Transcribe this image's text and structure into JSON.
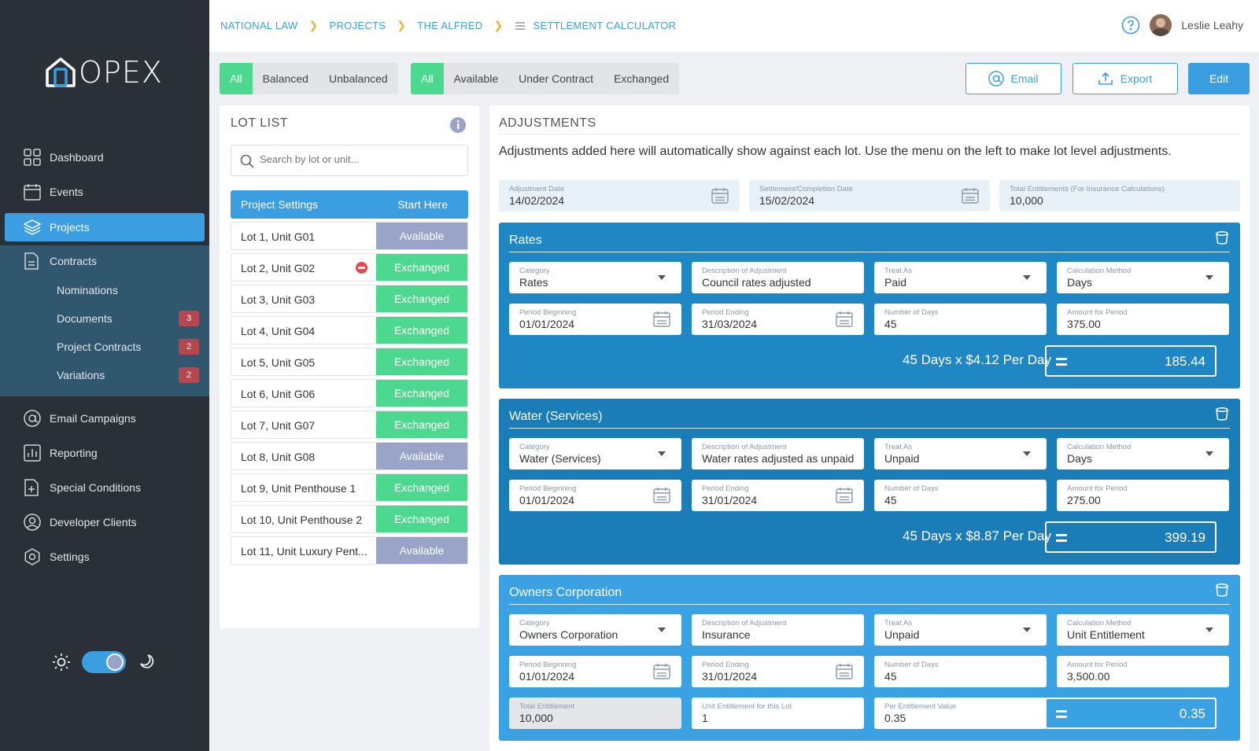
{
  "app": {
    "logo": "OPEX"
  },
  "sidebar": {
    "items": [
      {
        "label": "Dashboard"
      },
      {
        "label": "Events"
      },
      {
        "label": "Projects"
      },
      {
        "label": "Contracts"
      },
      {
        "label": "Email Campaigns"
      },
      {
        "label": "Reporting"
      },
      {
        "label": "Special Conditions"
      },
      {
        "label": "Developer Clients"
      },
      {
        "label": "Settings"
      }
    ],
    "sub_items": [
      {
        "label": "Nominations",
        "badge": ""
      },
      {
        "label": "Documents",
        "badge": "3"
      },
      {
        "label": "Project Contracts",
        "badge": "2"
      },
      {
        "label": "Variations",
        "badge": "2"
      }
    ]
  },
  "breadcrumb": [
    "NATIONAL LAW",
    "PROJECTS",
    "THE ALFRED",
    "SETTLEMENT CALCULATOR"
  ],
  "user": {
    "name": "Leslie Leahy"
  },
  "filters": {
    "balance": [
      "All",
      "Balanced",
      "Unbalanced"
    ],
    "status": [
      "All",
      "Available",
      "Under Contract",
      "Exchanged"
    ]
  },
  "actions": {
    "email": "Email",
    "export": "Export",
    "edit": "Edit"
  },
  "lot_list": {
    "title": "LOT LIST",
    "search_placeholder": "Search by lot or unit...",
    "project_settings": "Project Settings",
    "start_here": "Start Here",
    "lots": [
      {
        "name": "Lot 1, Unit G01",
        "status": "Available"
      },
      {
        "name": "Lot 2, Unit G02",
        "status": "Exchanged"
      },
      {
        "name": "Lot 3, Unit G03",
        "status": "Exchanged"
      },
      {
        "name": "Lot 4, Unit G04",
        "status": "Exchanged"
      },
      {
        "name": "Lot 5, Unit G05",
        "status": "Exchanged"
      },
      {
        "name": "Lot 6, Unit G06",
        "status": "Exchanged"
      },
      {
        "name": "Lot 7, Unit G07",
        "status": "Exchanged"
      },
      {
        "name": "Lot 8, Unit G08",
        "status": "Available"
      },
      {
        "name": "Lot 9, Unit Penthouse 1",
        "status": "Exchanged"
      },
      {
        "name": "Lot 10, Unit Penthouse 2",
        "status": "Exchanged"
      },
      {
        "name": "Lot 11, Unit Luxury Pent...",
        "status": "Available"
      }
    ]
  },
  "adjustments": {
    "title": "ADJUSTMENTS",
    "description": "Adjustments added here will automatically show against each lot. Use the menu on the left to make lot level adjustments.",
    "adjustment_date": {
      "label": "Adjustment Date",
      "value": "14/02/2024"
    },
    "settlement_date": {
      "label": "Settlement/Completion Date",
      "value": "15/02/2024"
    },
    "total_entitlements": {
      "label": "Total Entitlements (For Insurance Calculations)",
      "value": "10,000"
    },
    "labels": {
      "category": "Category",
      "description": "Description of Adjustment",
      "treat_as": "Treat As",
      "calc_method": "Calculation Method",
      "period_beginning": "Period Beginning",
      "period_ending": "Period Ending",
      "days": "Number of Days",
      "amount": "Amount for Period",
      "total_entitlement": "Total Entitlement",
      "unit_entitlement": "Unit Entitlement for this Lot",
      "per_entitlement": "Per Entitlement Value"
    },
    "rates": {
      "title": "Rates",
      "category": "Rates",
      "description": "Council rates adjusted",
      "treat_as": "Paid",
      "calc_method": "Days",
      "period_beginning": "01/01/2024",
      "period_ending": "31/03/2024",
      "days": "45",
      "amount": "375.00",
      "formula": "45 Days x $4.12 Per Day",
      "result": "185.44"
    },
    "water": {
      "title": "Water (Services)",
      "category": "Water (Services)",
      "description": "Water rates adjusted as unpaid",
      "treat_as": "Unpaid",
      "calc_method": "Days",
      "period_beginning": "01/01/2024",
      "period_ending": "31/01/2024",
      "days": "45",
      "amount": "275.00",
      "formula": "45 Days x $8.87 Per Day",
      "result": "399.19"
    },
    "owners": {
      "title": "Owners Corporation",
      "category": "Owners Corporation",
      "description": "Insurance",
      "treat_as": "Unpaid",
      "calc_method": "Unit Entitlement",
      "period_beginning": "01/01/2024",
      "period_ending": "31/01/2024",
      "days": "45",
      "amount": "3,500.00",
      "total_entitlement": "10,000",
      "unit_entitlement": "1",
      "per_entitlement": "0.35",
      "result": "0.35"
    }
  },
  "colors": {
    "accent": "#3b9ee0",
    "exchanged": "#4cd98f",
    "available": "#9aa3c8",
    "rates_bg": "#1f87c4",
    "water_bg": "#1a7db8",
    "owners_bg": "#3aa2e2",
    "sidebar_bg": "#2b2f38"
  }
}
